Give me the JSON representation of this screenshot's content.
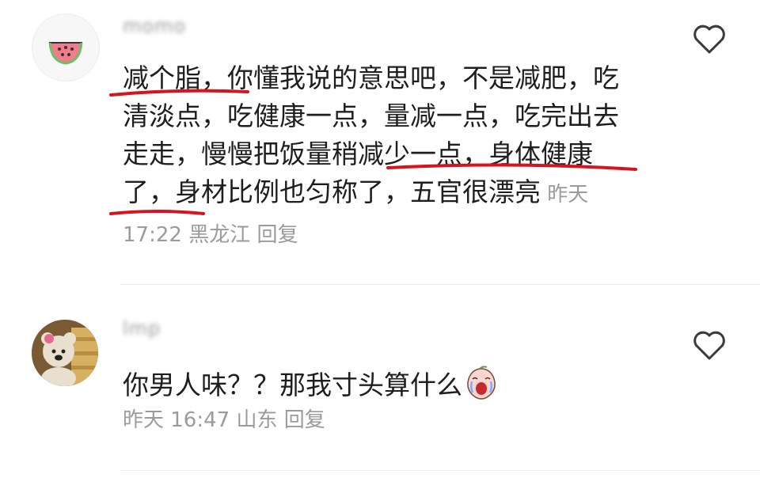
{
  "comments": [
    {
      "username": "momo",
      "avatar": "watermelon-avatar",
      "text": "减个脂，你懂我说的意思吧，不是减肥，吃清淡点，吃健康一点，量减一点，吃完出去走走，慢慢把饭量稍减少一点，身体健康了，身材比例也匀称了，五官很漂亮",
      "time": "昨天 17:22",
      "location": "黑龙江",
      "reply_label": "回复",
      "like_icon": "heart-outline-icon"
    },
    {
      "username": "lmp",
      "avatar": "teddy-bear-avatar",
      "text": "你男人味？？那我寸头算什么",
      "emoji": "crying-peach-emoji",
      "time": "昨天 16:47",
      "location": "山东",
      "reply_label": "回复",
      "like_icon": "heart-outline-icon"
    }
  ],
  "colors": {
    "annotation": "#d6141f",
    "meta": "#9b9b9b",
    "text": "#1e1e1e"
  }
}
